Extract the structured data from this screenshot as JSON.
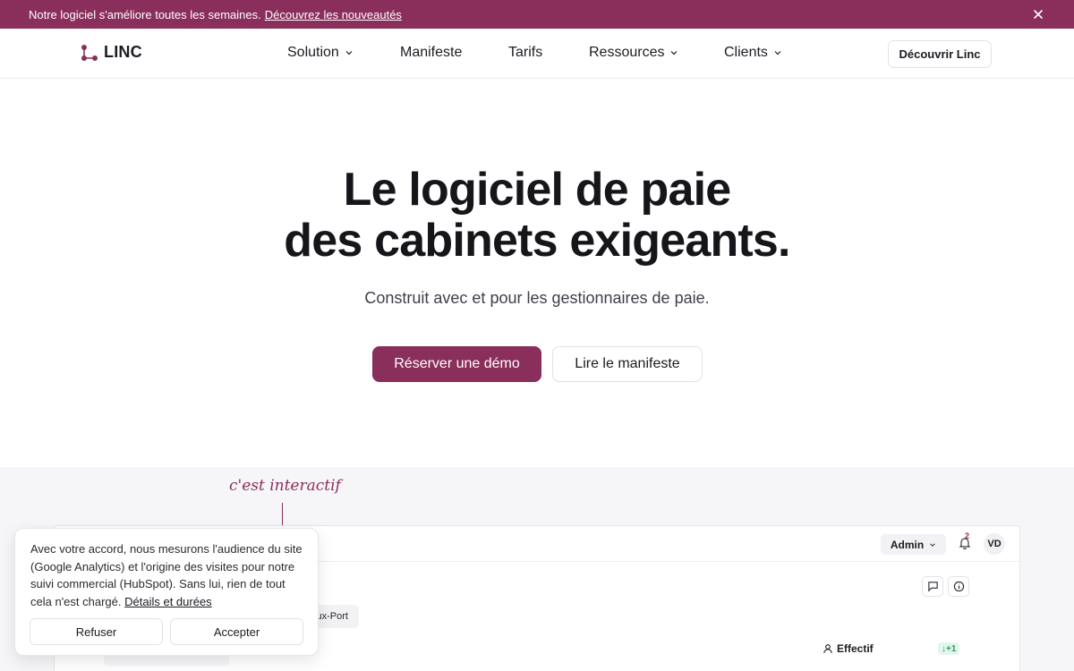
{
  "announcement": {
    "text": "Notre logiciel s'améliore toutes les semaines.",
    "link": "Découvrez les nouveautés"
  },
  "nav": {
    "logo": "LINC",
    "items": [
      {
        "label": "Solution",
        "dropdown": true
      },
      {
        "label": "Manifeste",
        "dropdown": false
      },
      {
        "label": "Tarifs",
        "dropdown": false
      },
      {
        "label": "Ressources",
        "dropdown": true
      },
      {
        "label": "Clients",
        "dropdown": true
      }
    ],
    "cta": "Découvrir Linc"
  },
  "hero": {
    "title_line1": "Le logiciel de paie",
    "title_line2": "des cabinets exigeants.",
    "subtitle": "Construit avec et pour les gestionnaires de paie.",
    "primary_cta": "Réserver une démo",
    "secondary_cta": "Lire le manifeste"
  },
  "demo": {
    "annotation": "c'est interactif",
    "role": "Admin",
    "notification_count": "2",
    "avatar_initials": "VD",
    "place_chip": "ux-Port",
    "effectif_label": "Effectif",
    "effectif_delta": "↓+1"
  },
  "cookie": {
    "text": "Avec votre accord, nous mesurons l'audience du site (Google Analytics) et l'origine des visites pour notre suivi commercial (HubSpot). Sans lui, rien de tout cela n'est chargé.",
    "link": "Détails et durées",
    "refuse": "Refuser",
    "accept": "Accepter"
  },
  "colors": {
    "brand": "#8a2e5c",
    "text": "#1c1b22",
    "demo_background": "#f6f6f8",
    "positive": "#2f9a5f"
  },
  "icons": [
    "close-icon",
    "logo-icon",
    "chevron-down-icon",
    "bell-icon",
    "comment-icon",
    "info-icon",
    "user-icon"
  ]
}
